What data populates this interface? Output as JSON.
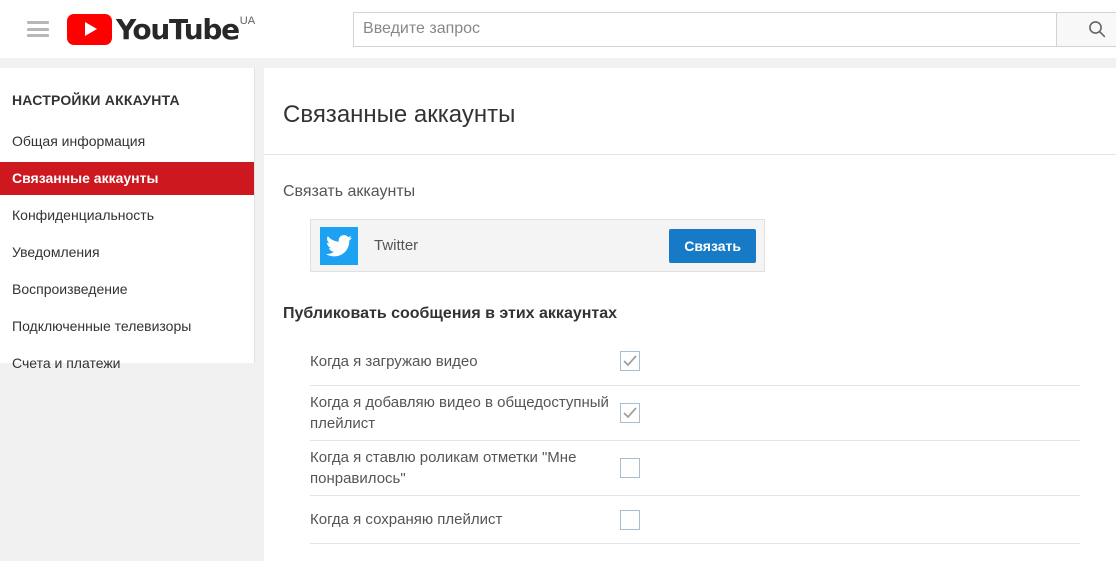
{
  "header": {
    "menu_icon": "hamburger-icon",
    "logo_text": "YouTube",
    "logo_country": "UA",
    "search_value": "",
    "search_placeholder": "Введите запрос",
    "search_icon": "search-icon"
  },
  "sidebar": {
    "title": "НАСТРОЙКИ АККАУНТА",
    "items": [
      {
        "label": "Общая информация",
        "active": false
      },
      {
        "label": "Связанные аккаунты",
        "active": true
      },
      {
        "label": "Конфиденциальность",
        "active": false
      },
      {
        "label": "Уведомления",
        "active": false
      },
      {
        "label": "Воспроизведение",
        "active": false
      },
      {
        "label": "Подключенные телевизоры",
        "active": false
      },
      {
        "label": "Счета и платежи",
        "active": false
      }
    ]
  },
  "main": {
    "page_title": "Связанные аккаунты",
    "link_section_label": "Связать аккаунты",
    "link_card": {
      "service_name": "Twitter",
      "service_icon": "twitter-bird-icon",
      "button_label": "Связать"
    },
    "post_section_label": "Публиковать сообщения в этих аккаунтах",
    "post_options": [
      {
        "label": "Когда я загружаю видео",
        "checked": true
      },
      {
        "label": "Когда я добавляю видео в общедоступный плейлист",
        "checked": true
      },
      {
        "label": "Когда я ставлю роликам отметки \"Мне понравилось\"",
        "checked": false
      },
      {
        "label": "Когда я сохраняю плейлист",
        "checked": false
      }
    ]
  },
  "colors": {
    "brand_red": "#ff0000",
    "active_red": "#cc181e",
    "twitter_blue": "#1da1f2",
    "button_blue": "#167ac6",
    "page_bg": "#f1f1f1"
  }
}
